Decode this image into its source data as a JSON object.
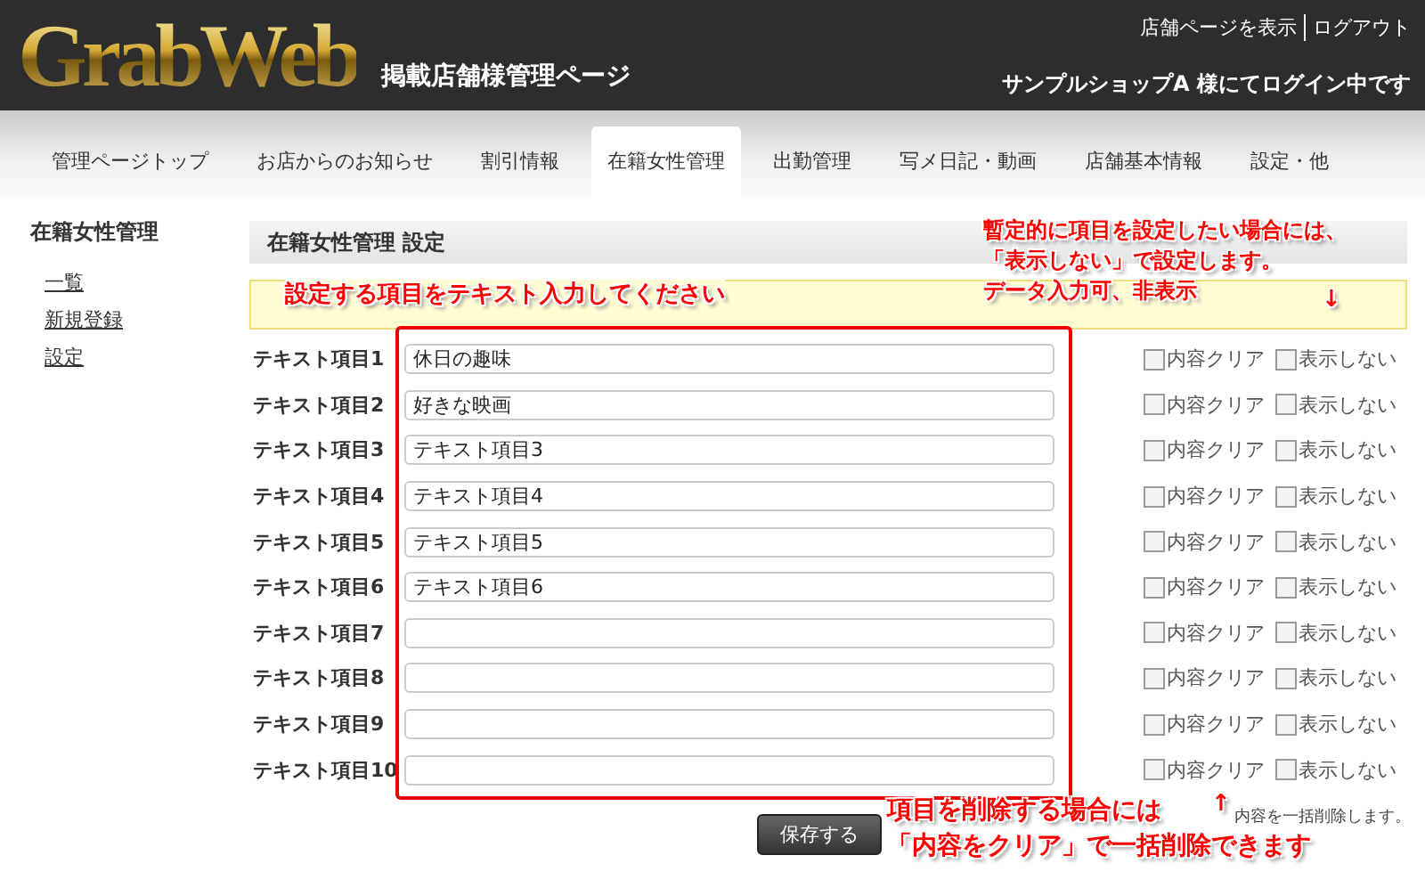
{
  "header": {
    "logo": "GrabWeb",
    "subtitle": "掲載店舗様管理ページ",
    "links": [
      "店舗ページを表示",
      "ログアウト"
    ],
    "login_status": "サンプルショップA 様にてログイン中です"
  },
  "tabs": [
    {
      "label": "管理ページトップ",
      "selected": false
    },
    {
      "label": "お店からのお知らせ",
      "selected": false
    },
    {
      "label": "割引情報",
      "selected": false
    },
    {
      "label": "在籍女性管理",
      "selected": true
    },
    {
      "label": "出勤管理",
      "selected": false
    },
    {
      "label": "写メ日記・動画",
      "selected": false
    },
    {
      "label": "店舗基本情報",
      "selected": false
    },
    {
      "label": "設定・他",
      "selected": false
    }
  ],
  "sidebar": {
    "title": "在籍女性管理",
    "items": [
      "一覧",
      "新規登録",
      "設定"
    ]
  },
  "section_title": "在籍女性管理  設定",
  "rows": [
    {
      "label": "テキスト項目1",
      "value": "休日の趣味",
      "clear_label": "内容クリア",
      "clear": false,
      "hide_label": "表示しない",
      "hide": false
    },
    {
      "label": "テキスト項目2",
      "value": "好きな映画",
      "clear_label": "内容クリア",
      "clear": false,
      "hide_label": "表示しない",
      "hide": false
    },
    {
      "label": "テキスト項目3",
      "value": "テキスト項目3",
      "clear_label": "内容クリア",
      "clear": false,
      "hide_label": "表示しない",
      "hide": false
    },
    {
      "label": "テキスト項目4",
      "value": "テキスト項目4",
      "clear_label": "内容クリア",
      "clear": false,
      "hide_label": "表示しない",
      "hide": false
    },
    {
      "label": "テキスト項目5",
      "value": "テキスト項目5",
      "clear_label": "内容クリア",
      "clear": false,
      "hide_label": "表示しない",
      "hide": false
    },
    {
      "label": "テキスト項目6",
      "value": "テキスト項目6",
      "clear_label": "内容クリア",
      "clear": false,
      "hide_label": "表示しない",
      "hide": false
    },
    {
      "label": "テキスト項目7",
      "clear_label": "内容クリア",
      "clear": false,
      "hide_label": "表示しない",
      "hide": false
    },
    {
      "label": "テキスト項目8",
      "clear_label": "内容クリア",
      "clear": false,
      "hide_label": "表示しない",
      "hide": false
    },
    {
      "label": "テキスト項目9",
      "clear_label": "内容クリア",
      "clear": false,
      "hide_label": "表示しない",
      "hide": false
    },
    {
      "label": "テキスト項目10",
      "clear_label": "内容クリア",
      "clear": false,
      "hide_label": "表示しない",
      "hide": false
    }
  ],
  "footer_note": "内容を一括削除します。",
  "save_button": "保存する",
  "annotations": {
    "input_hint": "設定する項目をテキスト入力してください",
    "hide_hint": [
      "暫定的に項目を設定したい場合には、",
      "「表示しない」で設定します。",
      "データ入力可、非表示"
    ],
    "hide_arrow": "↓",
    "clear_hint": [
      "項目を削除する場合には",
      "「内容をクリア」で一括削除できます"
    ],
    "clear_arrow": "↑"
  }
}
